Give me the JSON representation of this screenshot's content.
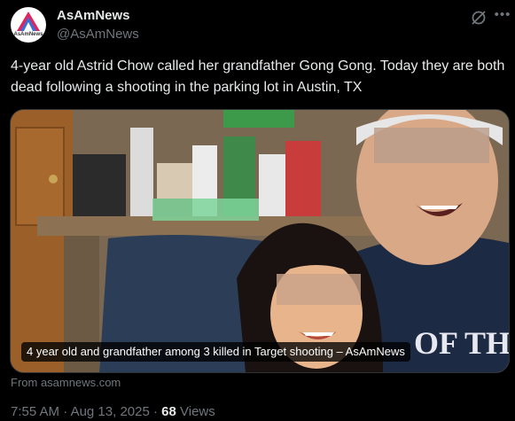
{
  "account": {
    "name": "AsAmNews",
    "handle": "@AsAmNews",
    "avatar_text": "AsAmNews"
  },
  "header_icons": [
    "grok-icon",
    "more-icon"
  ],
  "post": {
    "text": "4-year old Astrid Chow called her grandfather Gong Gong. Today they are both dead following a shooting in the parking lot in Austin, TX"
  },
  "media": {
    "caption": "4 year old and grandfather among 3 killed in Target shooting – AsAmNews",
    "shirt_text": "OF THE MI"
  },
  "link_source": "From asamnews.com",
  "meta": {
    "time": "7:55 AM",
    "date": "Aug 13, 2025",
    "separator": "·",
    "views_count": "68",
    "views_label": "Views"
  },
  "colors": {
    "background": "#000000",
    "text_primary": "#e7e9ea",
    "text_secondary": "#71767b",
    "border": "#2f3336"
  }
}
